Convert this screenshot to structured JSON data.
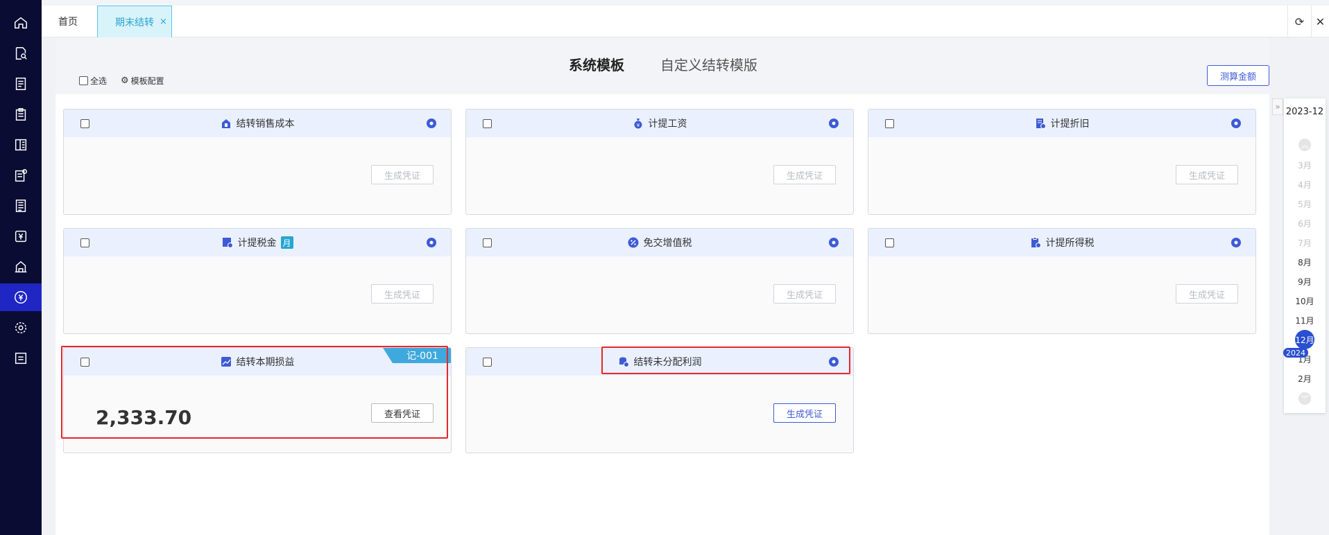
{
  "nav": {
    "icons": [
      "home-icon",
      "search-document-icon",
      "ledger-icon",
      "clipboard-icon",
      "book-icon",
      "voucher-settings-icon",
      "report-icon",
      "yen-icon",
      "building-icon",
      "yen-circle-icon",
      "settings-icon",
      "list-icon"
    ],
    "active_index": 9
  },
  "tabs": {
    "home": "首页",
    "active": "期末结转",
    "close": "×"
  },
  "toolbar": {
    "refresh": "⟳",
    "close": "✕"
  },
  "header": {
    "system_title": "系统模板",
    "custom_title": "自定义结转模版",
    "select_all": "全选",
    "template_config": "模板配置",
    "calc_button": "测算金额"
  },
  "cards": [
    {
      "title": "结转销售成本",
      "icon": "house-tag-icon",
      "button": "生成凭证"
    },
    {
      "title": "计提工资",
      "icon": "money-bag-icon",
      "button": "生成凭证"
    },
    {
      "title": "计提折旧",
      "icon": "document-clock-icon",
      "button": "生成凭证"
    },
    {
      "title": "计提税金",
      "badge": "月",
      "icon": "tax-icon",
      "button": "生成凭证"
    },
    {
      "title": "免交增值税",
      "icon": "percent-icon",
      "button": "生成凭证"
    },
    {
      "title": "计提所得税",
      "icon": "clipboard-tax-icon",
      "button": "生成凭证"
    },
    {
      "title": "结转本期损益",
      "icon": "chart-icon",
      "button": "查看凭证",
      "amount": "2,333.70",
      "voucher_tag": "记-001"
    },
    {
      "title": "结转未分配利润",
      "icon": "coins-icon",
      "button": "生成凭证"
    }
  ],
  "period": {
    "year_month": "2023-12",
    "months": [
      "3月",
      "4月",
      "5月",
      "6月",
      "7月",
      "8月",
      "9月",
      "10月",
      "11月",
      "12月",
      "1月",
      "2月"
    ],
    "selected": "12月",
    "next_year": "2024"
  },
  "colors": {
    "accent": "#3d5bd6",
    "nav_bg": "#0b0c33",
    "highlight": "#e8262a",
    "tag": "#3fa9dd"
  }
}
